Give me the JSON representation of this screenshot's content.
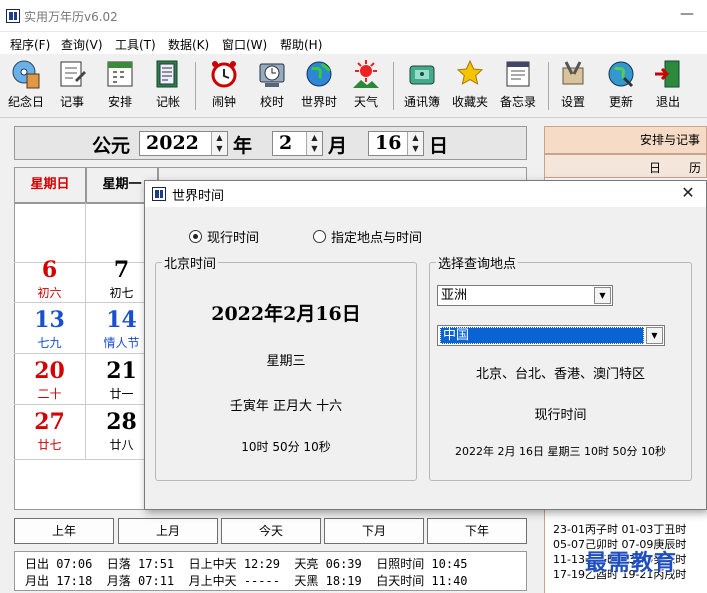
{
  "window": {
    "title": "实用万年历v6.02",
    "minimize_label": "—"
  },
  "menu": [
    {
      "label": "程序(F)"
    },
    {
      "label": "查询(V)"
    },
    {
      "label": "工具(T)"
    },
    {
      "label": "数据(K)"
    },
    {
      "label": "窗口(W)"
    },
    {
      "label": "帮助(H)"
    }
  ],
  "toolbar": [
    {
      "label": "纪念日",
      "icon": "cd-icon"
    },
    {
      "label": "记事",
      "icon": "notebook-icon"
    },
    {
      "label": "安排",
      "icon": "schedule-icon"
    },
    {
      "label": "记帐",
      "icon": "ledger-icon"
    },
    {
      "label": "闹钟",
      "icon": "alarm-clock-icon"
    },
    {
      "label": "校时",
      "icon": "sync-clock-icon"
    },
    {
      "label": "世界时",
      "icon": "globe-icon"
    },
    {
      "label": "天气",
      "icon": "weather-icon"
    },
    {
      "label": "通讯簿",
      "icon": "phone-icon"
    },
    {
      "label": "收藏夹",
      "icon": "star-icon"
    },
    {
      "label": "备忘录",
      "icon": "memo-icon"
    },
    {
      "label": "设置",
      "icon": "tools-icon"
    },
    {
      "label": "更新",
      "icon": "update-icon"
    },
    {
      "label": "退出",
      "icon": "exit-door-icon"
    }
  ],
  "datebar": {
    "era": "公元",
    "year": "2022",
    "year_unit": "年",
    "month": "2",
    "month_unit": "月",
    "day": "16",
    "day_unit": "日"
  },
  "weekdays": [
    {
      "label": "星期日",
      "color": "#d40000"
    },
    {
      "label": "星期一",
      "color": "#000000"
    }
  ],
  "calendar": {
    "rows": [
      [
        {
          "num": "",
          "sub": "",
          "color": "#000000"
        },
        {
          "num": "",
          "sub": "",
          "color": "#000000"
        }
      ],
      [
        {
          "num": "6",
          "sub": "初六",
          "color": "#d40000"
        },
        {
          "num": "7",
          "sub": "初七",
          "color": "#000000"
        }
      ],
      [
        {
          "num": "13",
          "sub": "七九",
          "color": "#1a4fd0"
        },
        {
          "num": "14",
          "sub": "情人节",
          "color": "#1a4fd0"
        }
      ],
      [
        {
          "num": "20",
          "sub": "二十",
          "color": "#d40000"
        },
        {
          "num": "21",
          "sub": "廿一",
          "color": "#000000"
        }
      ],
      [
        {
          "num": "27",
          "sub": "廿七",
          "color": "#d40000"
        },
        {
          "num": "28",
          "sub": "廿八",
          "color": "#000000"
        }
      ]
    ]
  },
  "nav": {
    "prev_year": "上年",
    "prev_month": "上月",
    "today": "今天",
    "next_month": "下月",
    "next_year": "下年"
  },
  "info": {
    "line1": "日出 07:06  日落 17:51  日上中天 12:29  天亮 06:39  日照时间 10:45",
    "line2": "月出 17:18  月落 07:11  月上中天 -----  天黑 18:19  白天时间 11:40"
  },
  "right_panel": {
    "header": "安排与记事",
    "tab1": "日",
    "tab2": "历",
    "hours": [
      "23-01丙子时 01-03丁丑时",
      "05-07己卯时 07-09庚辰时",
      "11-13壬午时 13-15癸未时",
      "17-19乙酉时 19-21丙戌时"
    ]
  },
  "watermark": "最需教育",
  "dialog": {
    "title": "世界时间",
    "close_label": "✕",
    "radio_current": "现行时间",
    "radio_custom": "指定地点与时间",
    "beijing": {
      "legend": "北京时间",
      "date": "2022年2月16日",
      "weekday": "星期三",
      "lunar": "壬寅年 正月大 十六",
      "time": "10时 50分 10秒"
    },
    "location": {
      "legend": "选择查询地点",
      "continent": "亚洲",
      "country": "中国",
      "cities": "北京、台北、香港、澳门特区",
      "current_label": "现行时间",
      "current_value": "2022年 2月 16日 星期三 10时 50分 10秒"
    }
  }
}
